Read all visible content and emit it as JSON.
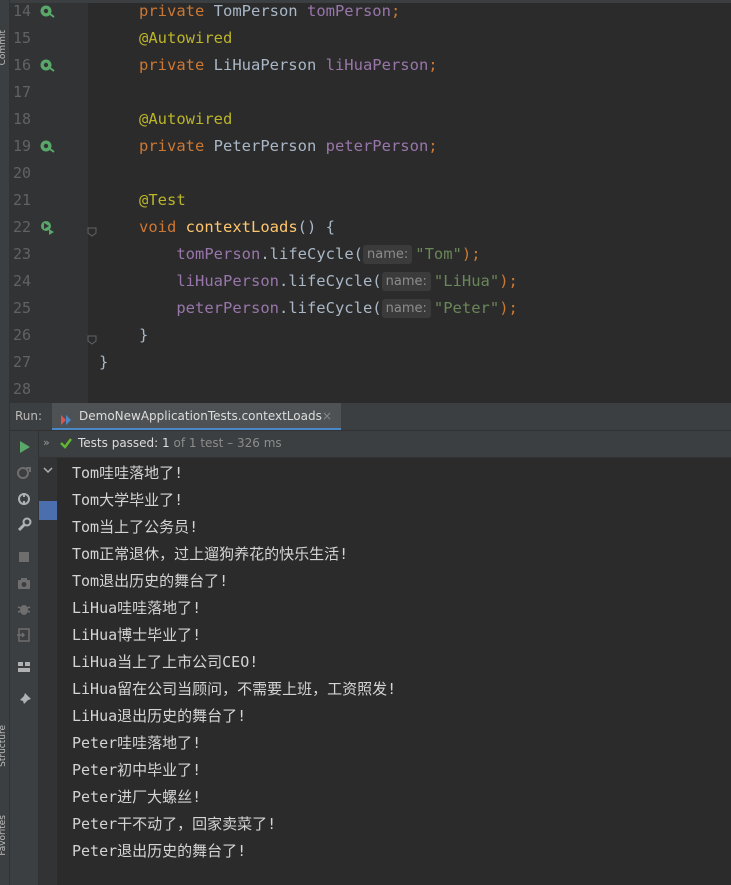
{
  "sidebar": {
    "labels": [
      "Commit",
      "Structure",
      "Favorites"
    ]
  },
  "editor": {
    "lines": [
      {
        "num": "14",
        "segments": [
          {
            "t": "private ",
            "c": "kw"
          },
          {
            "t": "TomPerson ",
            "c": "typ"
          },
          {
            "t": "tomPerson",
            "c": "fld"
          },
          {
            "t": ";",
            "c": "kw"
          }
        ],
        "icon": "bean-icon"
      },
      {
        "num": "15",
        "segments": [
          {
            "t": "@Autowired",
            "c": "ann"
          }
        ]
      },
      {
        "num": "16",
        "segments": [
          {
            "t": "private ",
            "c": "kw"
          },
          {
            "t": "LiHuaPerson ",
            "c": "typ"
          },
          {
            "t": "liHuaPerson",
            "c": "fld"
          },
          {
            "t": ";",
            "c": "kw"
          }
        ],
        "icon": "bean-icon"
      },
      {
        "num": "17",
        "segments": []
      },
      {
        "num": "18",
        "segments": [
          {
            "t": "@Autowired",
            "c": "ann"
          }
        ]
      },
      {
        "num": "19",
        "segments": [
          {
            "t": "private ",
            "c": "kw"
          },
          {
            "t": "PeterPerson ",
            "c": "typ"
          },
          {
            "t": "peterPerson",
            "c": "fld"
          },
          {
            "t": ";",
            "c": "kw"
          }
        ],
        "icon": "bean-icon"
      },
      {
        "num": "20",
        "segments": []
      },
      {
        "num": "21",
        "segments": [
          {
            "t": "@Test",
            "c": "ann"
          }
        ]
      },
      {
        "num": "22",
        "segments": [
          {
            "t": "void ",
            "c": "kw"
          },
          {
            "t": "contextLoads",
            "c": "fn"
          },
          {
            "t": "() {",
            "c": "typ"
          }
        ],
        "icon": "run-test-icon",
        "fold": true
      },
      {
        "num": "23",
        "segments": [
          {
            "t": "    tomPerson",
            "c": "fld"
          },
          {
            "t": ".lifeCycle(",
            "c": "typ"
          },
          {
            "t": "name:",
            "c": "hint"
          },
          {
            "t": "\"Tom\"",
            "c": "str"
          },
          {
            "t": ");",
            "c": "kw"
          }
        ]
      },
      {
        "num": "24",
        "segments": [
          {
            "t": "    liHuaPerson",
            "c": "fld"
          },
          {
            "t": ".lifeCycle(",
            "c": "typ"
          },
          {
            "t": "name:",
            "c": "hint"
          },
          {
            "t": "\"LiHua\"",
            "c": "str"
          },
          {
            "t": ");",
            "c": "kw"
          }
        ]
      },
      {
        "num": "25",
        "segments": [
          {
            "t": "    peterPerson",
            "c": "fld"
          },
          {
            "t": ".lifeCycle(",
            "c": "typ"
          },
          {
            "t": "name:",
            "c": "hint"
          },
          {
            "t": "\"Peter\"",
            "c": "str"
          },
          {
            "t": ");",
            "c": "kw"
          }
        ]
      },
      {
        "num": "26",
        "segments": [
          {
            "t": "}",
            "c": "typ"
          }
        ],
        "fold": true
      },
      {
        "num": "27",
        "segments": [
          {
            "t": "}",
            "c": "typ"
          }
        ],
        "outer": true
      },
      {
        "num": "28",
        "segments": []
      }
    ]
  },
  "run": {
    "label": "Run:",
    "tab_title": "DemoNewApplicationTests.contextLoads",
    "tab_close": "×",
    "status": {
      "prefix": "Tests passed: ",
      "count": "1",
      "rest": " of 1 test – 326 ms"
    },
    "console_lines": [
      "Tom哇哇落地了!",
      "Tom大学毕业了!",
      "Tom当上了公务员!",
      "Tom正常退休，过上遛狗养花的快乐生活!",
      "Tom退出历史的舞台了!",
      "LiHua哇哇落地了!",
      "LiHua博士毕业了!",
      "LiHua当上了上市公司CEO!",
      "LiHua留在公司当顾问，不需要上班，工资照发!",
      "LiHua退出历史的舞台了!",
      "Peter哇哇落地了!",
      "Peter初中毕业了!",
      "Peter进厂大螺丝!",
      "Peter干不动了，回家卖菜了!",
      "Peter退出历史的舞台了!"
    ]
  },
  "colors": {
    "keyword": "#cc7832",
    "annotation": "#bbb529",
    "field": "#9876aa",
    "method": "#ffc66d",
    "string": "#6a8759",
    "pass_green": "#5fb832",
    "tab_underline": "#4a88c7"
  }
}
